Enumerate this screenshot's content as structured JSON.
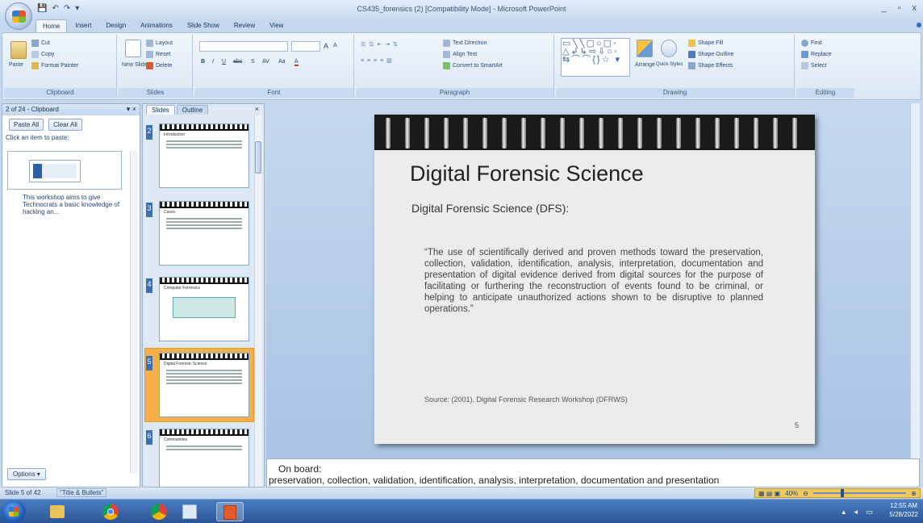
{
  "window": {
    "title": "CS435_forensics (2) [Compatibility Mode] - Microsoft PowerPoint",
    "controls": [
      "_",
      "▫",
      "x"
    ]
  },
  "qat": [
    "💾",
    "↶",
    "↷",
    "▾"
  ],
  "ribbon_tabs": [
    "Home",
    "Insert",
    "Design",
    "Animations",
    "Slide Show",
    "Review",
    "View"
  ],
  "ribbon": {
    "clipboard": {
      "label": "Clipboard",
      "paste": "Paste",
      "cut": "Cut",
      "copy": "Copy",
      "format_painter": "Format Painter"
    },
    "slides": {
      "label": "Slides",
      "new_slide": "New Slide",
      "layout": "Layout",
      "reset": "Reset",
      "delete": "Delete"
    },
    "font": {
      "label": "Font",
      "bold": "B",
      "italic": "I",
      "underline": "U",
      "strike": "abc",
      "shadow": "S",
      "spacing": "AV",
      "case": "Aa",
      "color": "A",
      "grow": "A",
      "shrink": "A"
    },
    "paragraph": {
      "label": "Paragraph",
      "text_direction": "Text Direction",
      "align_text": "Align Text",
      "smartart": "Convert to SmartArt"
    },
    "drawing": {
      "label": "Drawing",
      "arrange": "Arrange",
      "quick_styles": "Quick Styles",
      "shape_fill": "Shape Fill",
      "shape_outline": "Shape Outline",
      "shape_effects": "Shape Effects",
      "shapes_row1": "▭╲╲▢○▢◦",
      "shapes_row2": "△↲↳⇨⇩○◦",
      "shapes_row3": "⇆⌒⌒{}☆ ▾"
    },
    "editing": {
      "label": "Editing",
      "find": "Find",
      "replace": "Replace",
      "select": "Select"
    }
  },
  "clipboard_pane": {
    "header": "2 of 24 - Clipboard",
    "paste_all": "Paste All",
    "clear_all": "Clear All",
    "hint": "Click an item to paste:",
    "item_text": "This workshop aims to give Technocrats a basic knowledge of hacking an...",
    "options": "Options ▾"
  },
  "thumbs": {
    "tab_slides": "Slides",
    "tab_outline": "Outline",
    "items": [
      {
        "num": "2",
        "title": "Introduction"
      },
      {
        "num": "3",
        "title": "Cases"
      },
      {
        "num": "4",
        "title": "Computer Forensics"
      },
      {
        "num": "5",
        "title": "Digital Forensic Science"
      },
      {
        "num": "6",
        "title": "Communities"
      }
    ]
  },
  "slide": {
    "title": "Digital Forensic Science",
    "subtitle": "Digital Forensic Science (DFS):",
    "quote": "“The use of scientifically derived and proven methods toward the preservation, collection, validation, identification, analysis, interpretation, documentation and presentation of digital evidence derived from digital sources for the purpose of facilitating or furthering the reconstruction of events found to be criminal, or helping to anticipate unauthorized actions shown to be disruptive to planned operations.”",
    "source": "Source: (2001). Digital Forensic Research Workshop (DFRWS)",
    "number": "5"
  },
  "notes": {
    "line1": "On board:",
    "line2": "preservation, collection, validation, identification, analysis, interpretation, documentation and presentation"
  },
  "status": {
    "slide": "Slide 5 of 42",
    "theme": "\"Title & Bullets\"",
    "zoom": "40%"
  },
  "tray": {
    "time": "12:55 AM",
    "date": "5/28/2022"
  }
}
